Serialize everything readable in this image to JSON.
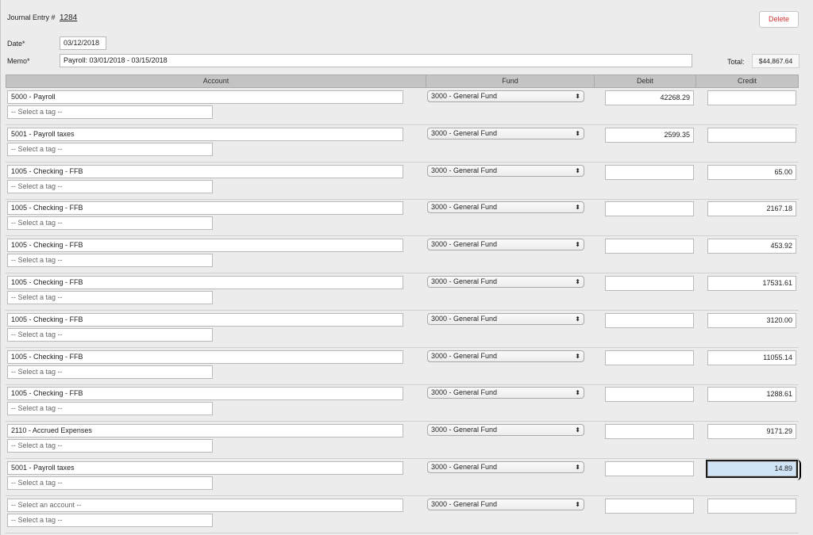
{
  "header": {
    "journal_entry_label": "Journal Entry #",
    "journal_entry_number": "1284",
    "date_label": "Date*",
    "date_value": "03/12/2018",
    "memo_label": "Memo*",
    "memo_value": "Payroll: 03/01/2018 - 03/15/2018",
    "delete_label": "Delete",
    "total_label": "Total:",
    "total_value": "$44,867.64"
  },
  "colors": {
    "delete_text": "#d0322f",
    "header_bg": "#c4c4c4",
    "focus_bg": "#cfe4f6"
  },
  "table": {
    "columns": [
      "Account",
      "Fund",
      "Debit",
      "Credit"
    ],
    "tag_placeholder": "-- Select a tag --",
    "rows": [
      {
        "account": "5000 - Payroll",
        "fund": "3000 - General Fund",
        "debit": "42268.29",
        "credit": ""
      },
      {
        "account": "5001 - Payroll taxes",
        "fund": "3000 - General Fund",
        "debit": "2599.35",
        "credit": ""
      },
      {
        "account": "1005 - Checking - FFB",
        "fund": "3000 - General Fund",
        "debit": "",
        "credit": "65.00"
      },
      {
        "account": "1005 - Checking - FFB",
        "fund": "3000 - General Fund",
        "debit": "",
        "credit": "2167.18"
      },
      {
        "account": "1005 - Checking - FFB",
        "fund": "3000 - General Fund",
        "debit": "",
        "credit": "453.92"
      },
      {
        "account": "1005 - Checking - FFB",
        "fund": "3000 - General Fund",
        "debit": "",
        "credit": "17531.61"
      },
      {
        "account": "1005 - Checking - FFB",
        "fund": "3000 - General Fund",
        "debit": "",
        "credit": "3120.00"
      },
      {
        "account": "1005 - Checking - FFB",
        "fund": "3000 - General Fund",
        "debit": "",
        "credit": "11055.14"
      },
      {
        "account": "1005 - Checking - FFB",
        "fund": "3000 - General Fund",
        "debit": "",
        "credit": "1288.61"
      },
      {
        "account": "2110 - Accrued Expenses",
        "fund": "3000 - General Fund",
        "debit": "",
        "credit": "9171.29"
      },
      {
        "account": "5001 - Payroll taxes",
        "fund": "3000 - General Fund",
        "debit": "",
        "credit": "14.89",
        "focused": true
      },
      {
        "account": "",
        "account_placeholder": "-- Select an account --",
        "fund": "3000 - General Fund",
        "debit": "",
        "credit": ""
      }
    ]
  }
}
